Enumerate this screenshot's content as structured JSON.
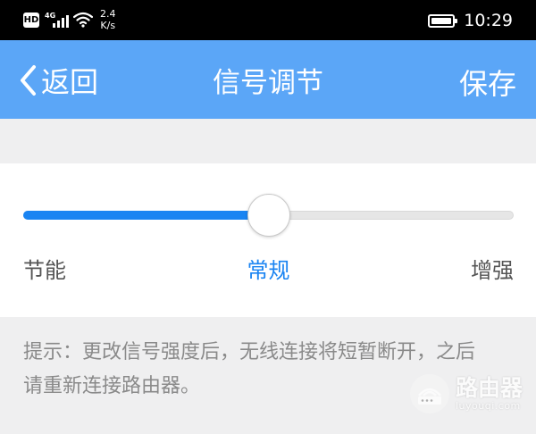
{
  "status_bar": {
    "hd": "HD",
    "network": "4G",
    "speed_value": "2.4",
    "speed_unit": "K/s",
    "battery_level": 1.0,
    "time": "10:29"
  },
  "header": {
    "back_label": "返回",
    "title": "信号调节",
    "save_label": "保存",
    "background_color": "#5ba6f7"
  },
  "slider": {
    "levels": [
      "节能",
      "常规",
      "增强"
    ],
    "selected_index": 1,
    "position": 0.5,
    "active_color": "#1a84f2"
  },
  "hint": {
    "text": "提示：更改信号强度后，无线连接将短暂断开，之后请重新连接路由器。"
  },
  "watermark": {
    "text_cn": "路由器",
    "text_en": "luyouqi.com",
    "icon": "router-icon"
  }
}
